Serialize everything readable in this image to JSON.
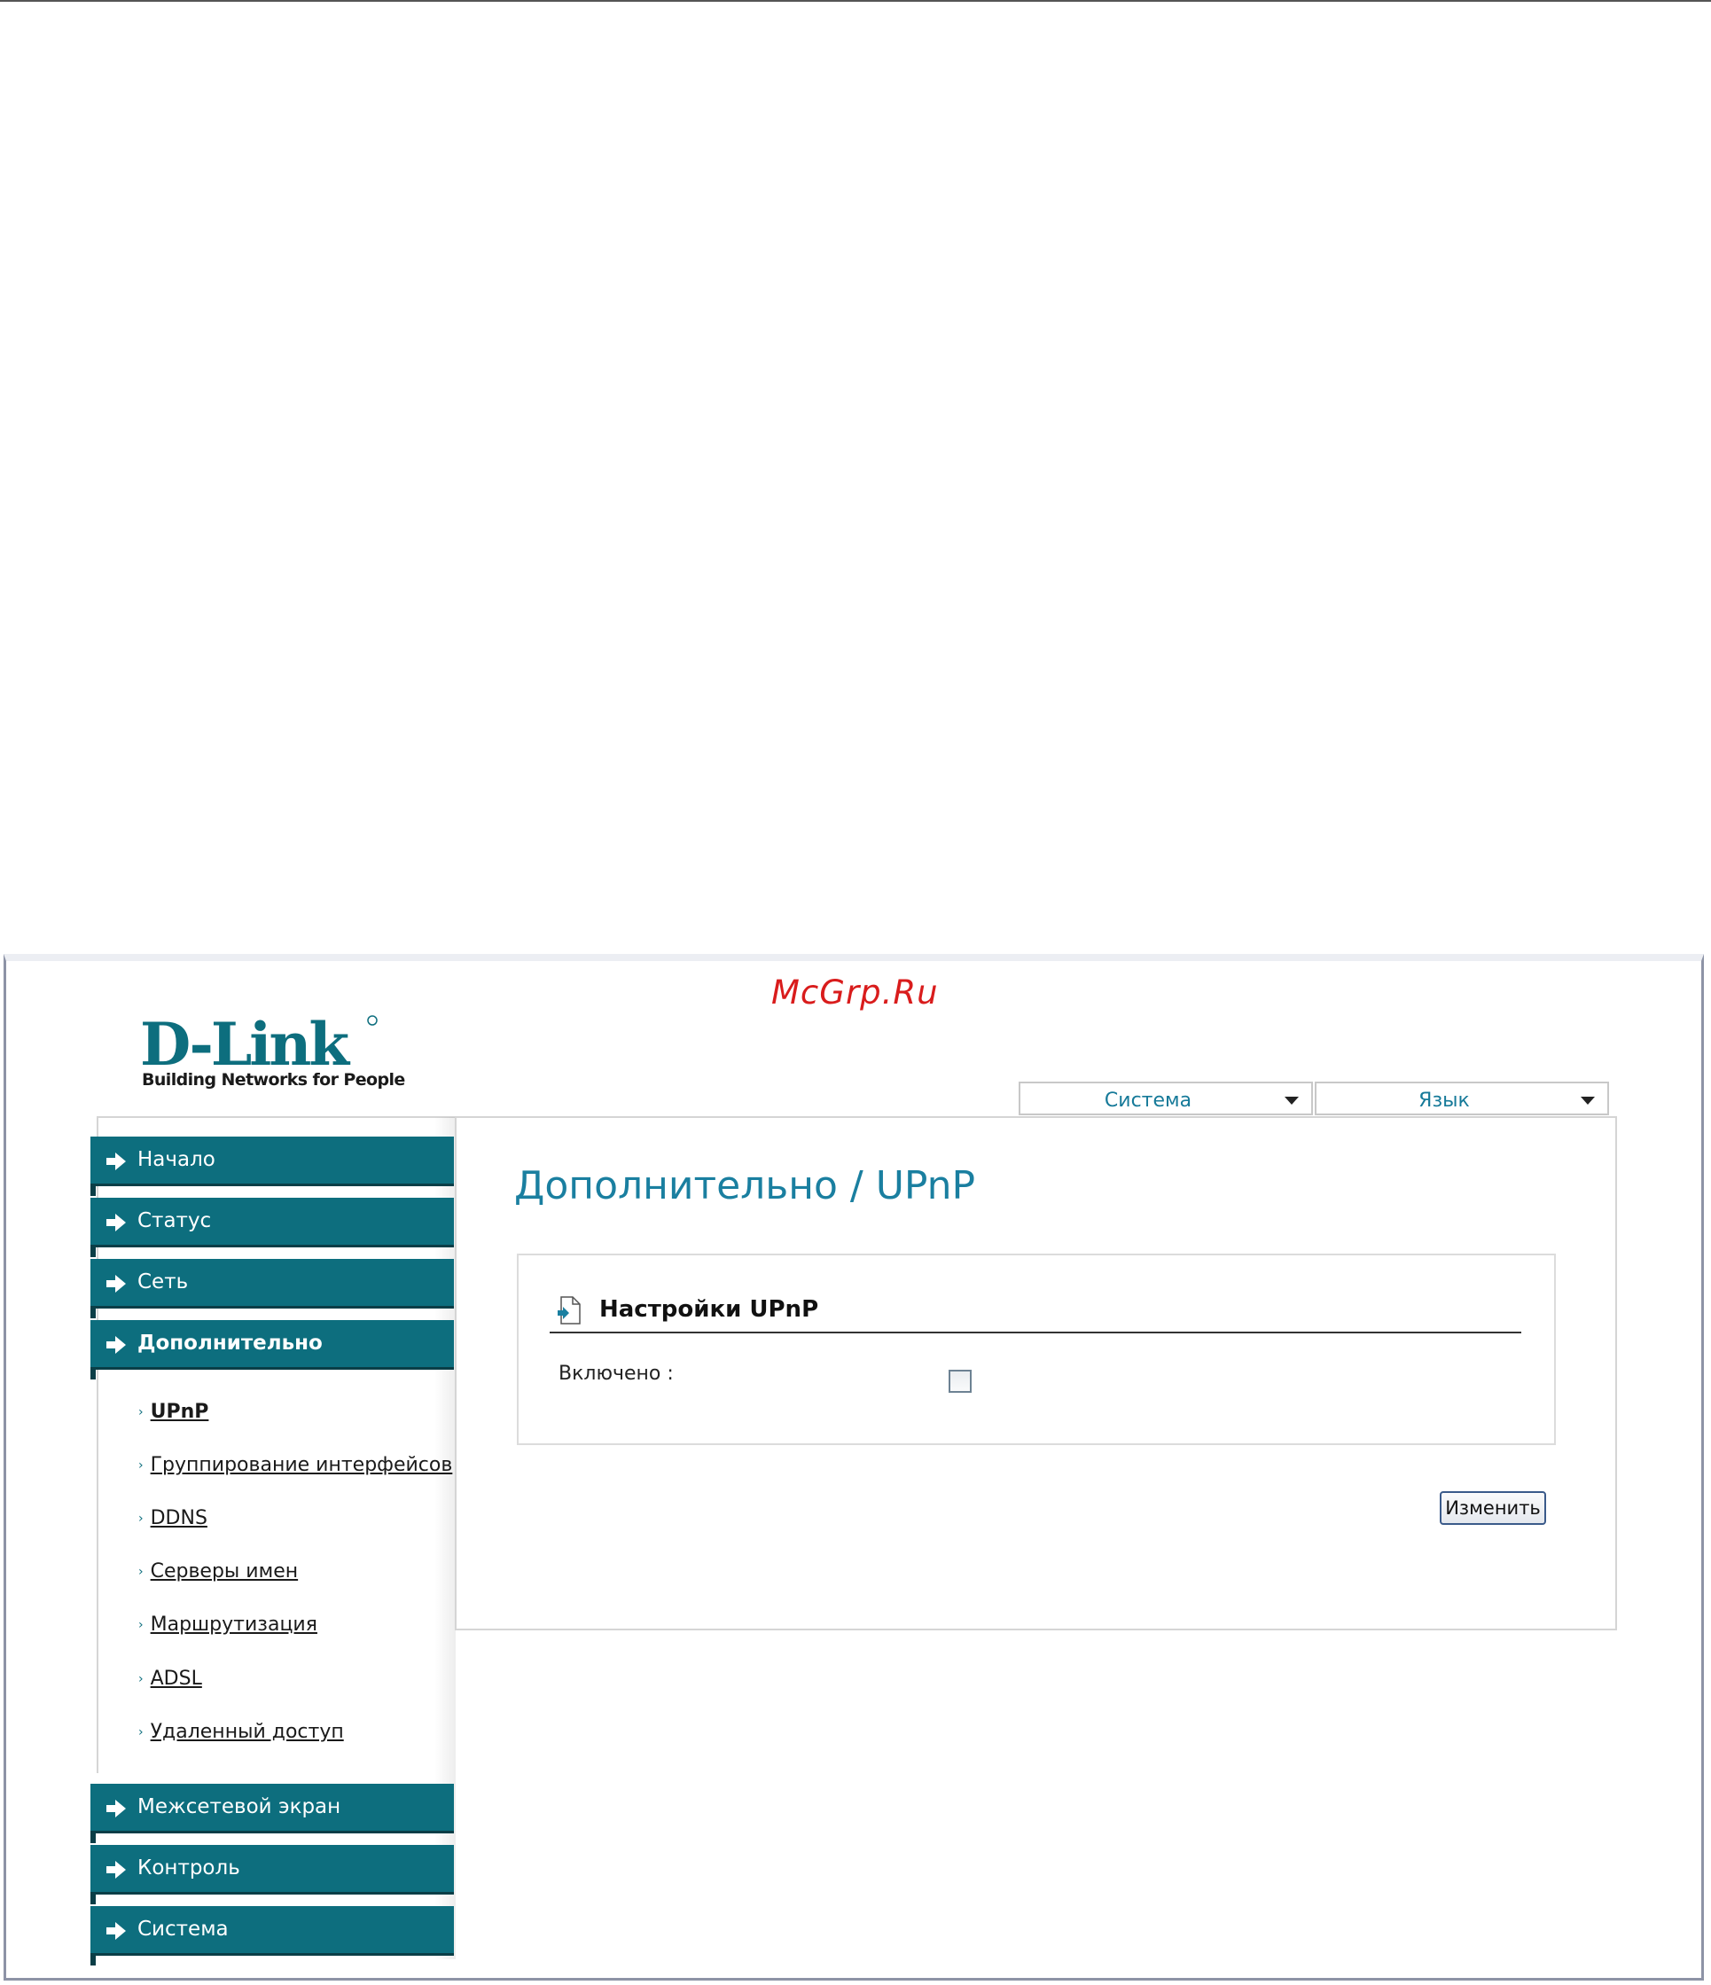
{
  "watermark": "McGrp.Ru",
  "brand": {
    "logo_text": "D-Link",
    "tagline": "Building Networks for People"
  },
  "top_menus": {
    "system": "Система",
    "language": "Язык"
  },
  "nav": {
    "items": [
      {
        "label": "Начало"
      },
      {
        "label": "Статус"
      },
      {
        "label": "Сеть"
      },
      {
        "label": "Дополнительно"
      },
      {
        "label": "Межсетевой экран"
      },
      {
        "label": "Контроль"
      },
      {
        "label": "Система"
      }
    ],
    "subitems": [
      {
        "label": "UPnP"
      },
      {
        "label": "Группирование интерфейсов"
      },
      {
        "label": "DDNS"
      },
      {
        "label": "Серверы имен"
      },
      {
        "label": "Маршрутизация"
      },
      {
        "label": "ADSL"
      },
      {
        "label": "Удаленный доступ"
      }
    ]
  },
  "main": {
    "title": "Дополнительно /  UPnP",
    "section_title": "Настройки UPnP",
    "enabled_label": "Включено :",
    "enabled_checked": false,
    "change_button": "Изменить"
  },
  "colors": {
    "nav_bg": "#0d6e7e",
    "title_color": "#1a7fa0",
    "watermark": "#d91c1c"
  }
}
